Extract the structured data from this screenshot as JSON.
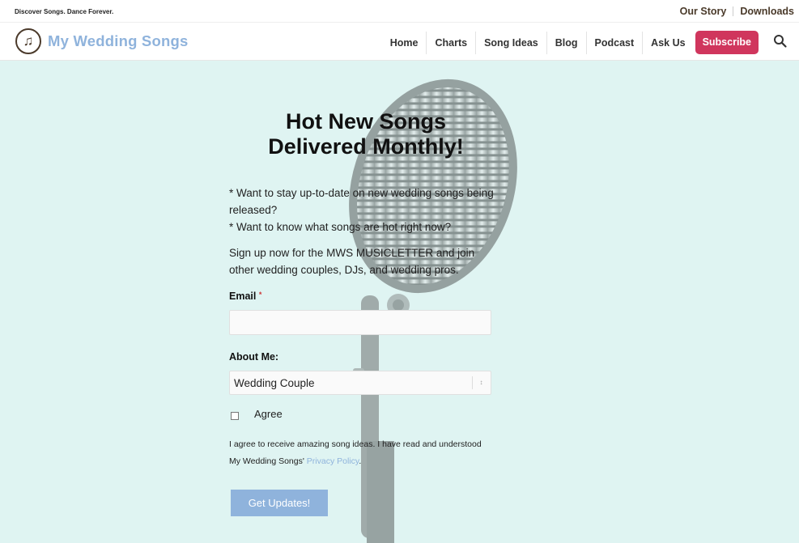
{
  "topbar": {
    "tagline": "Discover Songs. Dance Forever.",
    "links": [
      "Our Story",
      "Downloads"
    ]
  },
  "header": {
    "logo_text": "My Wedding Songs",
    "logo_icon": "music-note-icon",
    "nav": [
      "Home",
      "Charts",
      "Song Ideas",
      "Blog",
      "Podcast",
      "Ask Us"
    ],
    "subscribe_label": "Subscribe",
    "search_icon": "search-icon"
  },
  "hero": {
    "headline_line1": "Hot New Songs",
    "headline_line2": "Delivered Monthly!",
    "intro_line1": "* Want to stay up-to-date on new wedding songs being released?",
    "intro_line2": "* Want to know what songs are hot right now?",
    "signup_text": "Sign up now for the MWS MUSICLETTER and join other wedding couples, DJs, and wedding pros.",
    "email_label": "Email",
    "required_mark": "*",
    "email_value": "",
    "about_label": "About Me:",
    "about_selected": "Wedding Couple",
    "select_arrow": "↕",
    "agree_label": "Agree",
    "consent_text": "I agree to receive amazing song ideas. I have read and understood My Wedding Songs' ",
    "privacy_link": "Privacy Policy",
    "consent_end": ".",
    "submit_label": "Get Updates!"
  },
  "colors": {
    "accent_blue": "#8fb3dc",
    "subscribe_red": "#d0365d",
    "hero_bg": "#dff4f2",
    "brand_brown": "#4b3a2b"
  }
}
